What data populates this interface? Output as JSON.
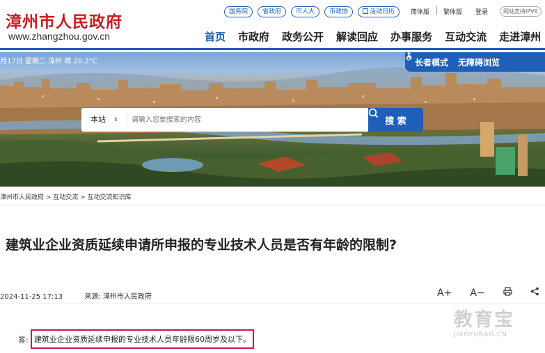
{
  "header": {
    "logo_cn": "漳州市人民政府",
    "logo_en": "www.zhangzhou.gov.cn",
    "top_links": [
      "国务院",
      "省政府",
      "市人大",
      "市政协",
      "活动日历"
    ],
    "lang_simplified": "简体版",
    "lang_traditional": "繁体版",
    "login": "登录",
    "ipv6": "网站支持IPV6",
    "nav": [
      "首页",
      "市政府",
      "政务公开",
      "解读回应",
      "办事服务",
      "互动交流",
      "走进漳州"
    ]
  },
  "banner": {
    "info": "月17日 星期二  漳州 晴 20.2°C",
    "elder_mode": "长者模式",
    "accessibility": "无障碍浏览",
    "search": {
      "scope": "本站",
      "placeholder": "请输入您要搜索的内容",
      "button": "搜 索"
    }
  },
  "breadcrumb": "漳州市人民政府 > 互动交流 > 互动交流知识库",
  "article": {
    "title": "建筑业企业资质延续申请所申报的专业技术人员是否有年龄的限制?",
    "date": "2024-11-25 17:13",
    "source": "来源:  漳州市人民政府",
    "font_increase": "A+",
    "font_decrease": "A−",
    "answer_label": "答:",
    "answer": "建筑业企业资质延续申报的专业技术人员年龄限60周岁及以下。"
  },
  "watermark": {
    "cn": "教育宝",
    "en": "JIAOYUBAO.CN"
  },
  "colors": {
    "brand_blue": "#1f5fb8",
    "logo_red": "#c81e1e",
    "highlight": "#c2185b"
  }
}
